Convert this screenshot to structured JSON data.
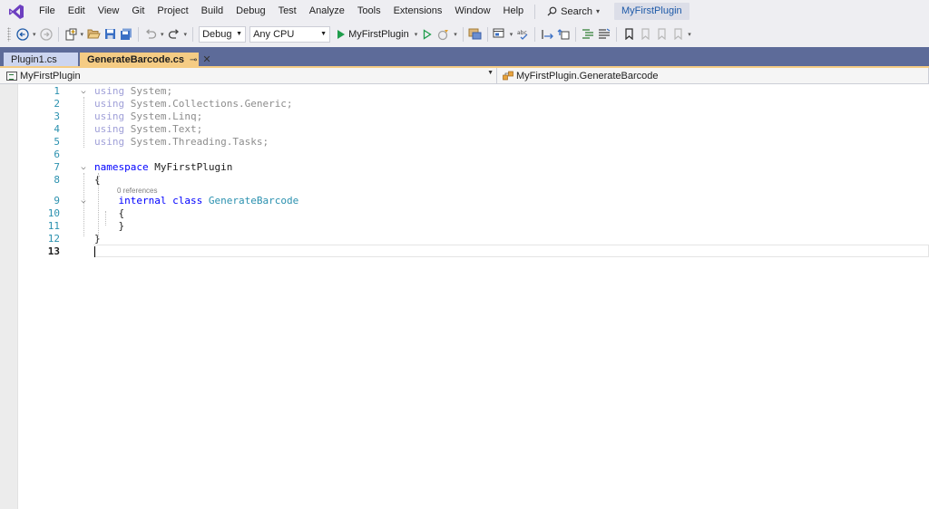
{
  "menu": {
    "items": [
      "File",
      "Edit",
      "View",
      "Git",
      "Project",
      "Build",
      "Debug",
      "Test",
      "Analyze",
      "Tools",
      "Extensions",
      "Window",
      "Help"
    ],
    "search_label": "Search",
    "project_chip": "MyFirstPlugin"
  },
  "toolbar": {
    "configuration": "Debug",
    "platform": "Any CPU",
    "start_target": "MyFirstPlugin"
  },
  "tabs": [
    {
      "label": "Plugin1.cs",
      "active": false
    },
    {
      "label": "GenerateBarcode.cs",
      "active": true
    }
  ],
  "navbar": {
    "project": "MyFirstPlugin",
    "member": "MyFirstPlugin.GenerateBarcode"
  },
  "editor": {
    "codelens": "0 references",
    "lines": [
      {
        "num": "1",
        "parts": [
          {
            "t": "using",
            "c": "kw-dim"
          },
          {
            "t": " System;",
            "c": "txt-dim"
          }
        ]
      },
      {
        "num": "2",
        "parts": [
          {
            "t": "using",
            "c": "kw-dim"
          },
          {
            "t": " System.Collections.Generic;",
            "c": "txt-dim"
          }
        ]
      },
      {
        "num": "3",
        "parts": [
          {
            "t": "using",
            "c": "kw-dim"
          },
          {
            "t": " System.Linq;",
            "c": "txt-dim"
          }
        ]
      },
      {
        "num": "4",
        "parts": [
          {
            "t": "using",
            "c": "kw-dim"
          },
          {
            "t": " System.Text;",
            "c": "txt-dim"
          }
        ]
      },
      {
        "num": "5",
        "parts": [
          {
            "t": "using",
            "c": "kw-dim"
          },
          {
            "t": " System.Threading.Tasks;",
            "c": "txt-dim"
          }
        ]
      },
      {
        "num": "6",
        "parts": []
      },
      {
        "num": "7",
        "parts": [
          {
            "t": "namespace",
            "c": "kw"
          },
          {
            "t": " MyFirstPlugin",
            "c": "plain"
          }
        ]
      },
      {
        "num": "8",
        "parts": [
          {
            "t": "{",
            "c": "plain"
          }
        ]
      },
      {
        "num": "9",
        "parts": [
          {
            "t": "    internal",
            "c": "kw"
          },
          {
            "t": " ",
            "c": "plain"
          },
          {
            "t": "class",
            "c": "kw"
          },
          {
            "t": " ",
            "c": "plain"
          },
          {
            "t": "GenerateBarcode",
            "c": "cls"
          }
        ]
      },
      {
        "num": "10",
        "parts": [
          {
            "t": "    {",
            "c": "plain"
          }
        ]
      },
      {
        "num": "11",
        "parts": [
          {
            "t": "    }",
            "c": "plain"
          }
        ]
      },
      {
        "num": "12",
        "parts": [
          {
            "t": "}",
            "c": "plain"
          }
        ]
      },
      {
        "num": "13",
        "parts": []
      }
    ]
  }
}
